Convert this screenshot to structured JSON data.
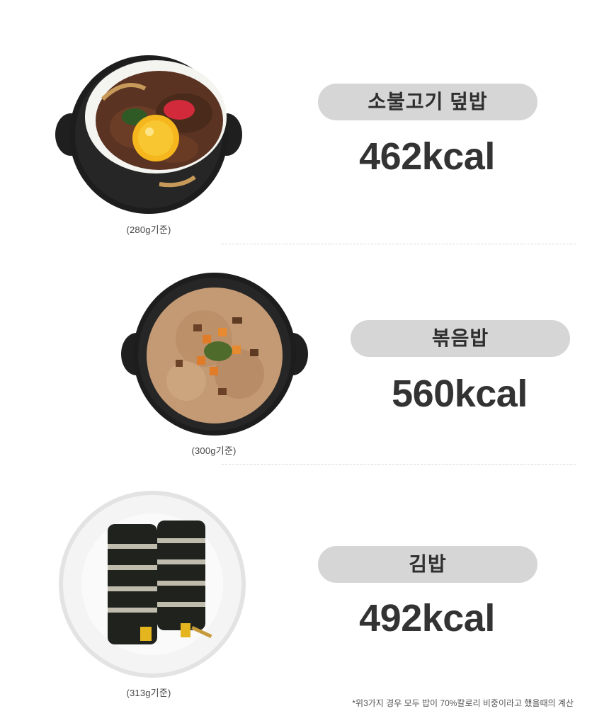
{
  "items": [
    {
      "name": "소불고기 덮밥",
      "calories": "462kcal",
      "weight_note": "(280g기준)",
      "dish_icon": "bulgogi-rice-bowl-image"
    },
    {
      "name": "볶음밥",
      "calories": "560kcal",
      "weight_note": "(300g기준)",
      "dish_icon": "fried-rice-bowl-image"
    },
    {
      "name": "김밥",
      "calories": "492kcal",
      "weight_note": "(313g기준)",
      "dish_icon": "gimbap-plate-image"
    }
  ],
  "footnote": "*위3가지 경우 모두 밥이 70%칼로리 비중이라고 했을때의 계산",
  "colors": {
    "pill_background": "#d6d6d6",
    "text": "#333333",
    "divider": "#d9d9d9",
    "pan": "#1d1d1d",
    "plate": "#f2f2f2"
  }
}
